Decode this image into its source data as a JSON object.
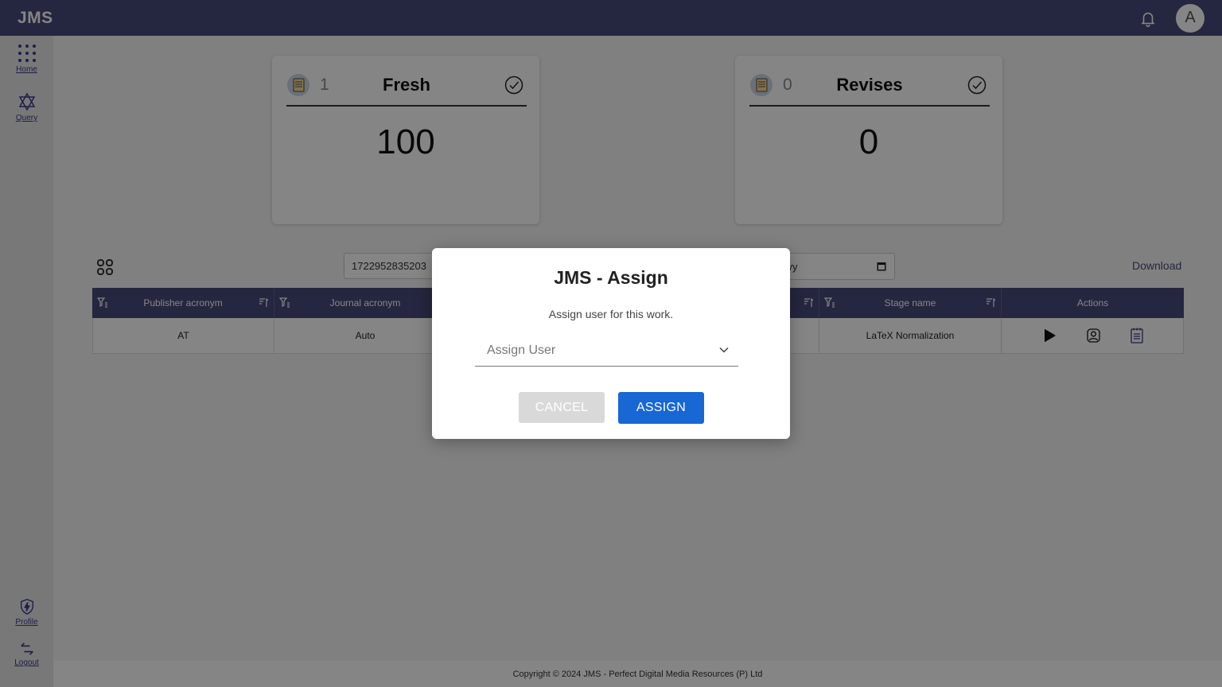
{
  "app": {
    "brand": "JMS",
    "avatar_letter": "A"
  },
  "sidebar": {
    "items": [
      {
        "label": "Home",
        "icon": "grid-dots-icon"
      },
      {
        "label": "Query",
        "icon": "star-of-david-icon"
      },
      {
        "label": "Profile",
        "icon": "shield-bolt-icon"
      },
      {
        "label": "Logout",
        "icon": "logout-arrows-icon"
      }
    ]
  },
  "cards": [
    {
      "count": "1",
      "title": "Fresh",
      "value": "100",
      "icon": "document-list-icon"
    },
    {
      "count": "0",
      "title": "Revises",
      "value": "0",
      "icon": "document-list-icon"
    }
  ],
  "toolbar": {
    "search_value": "1722952835203",
    "date_text": "yyy",
    "download_label": "Download"
  },
  "table": {
    "columns": [
      "Publisher acronym",
      "Journal acronym",
      "Stage name",
      "Actions"
    ],
    "rows": [
      {
        "publisher": "AT",
        "journal": "Auto",
        "stage": "LaTeX Normalization"
      }
    ],
    "actions": [
      "play-icon",
      "assign-user-icon",
      "notes-icon"
    ]
  },
  "modal": {
    "title": "JMS - Assign",
    "text": "Assign user for this work.",
    "select_placeholder": "Assign User",
    "cancel_label": "CANCEL",
    "assign_label": "ASSIGN"
  },
  "footer": {
    "text": "Copyright © 2024 JMS - Perfect Digital Media Resources (P) Ltd"
  },
  "colors": {
    "header": "#484a7a",
    "primary_button": "#1767d4",
    "sidebar": "#e6e6e6"
  }
}
